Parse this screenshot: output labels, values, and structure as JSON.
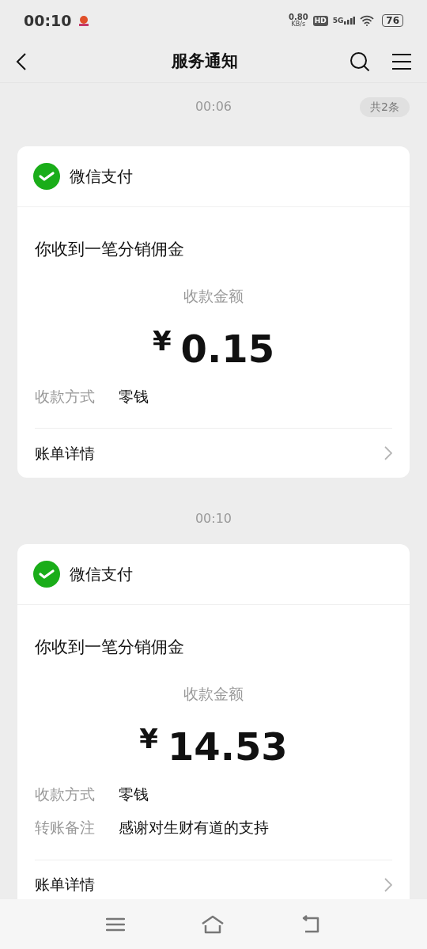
{
  "status_bar": {
    "time": "00:10",
    "speed": "0.80",
    "speed_unit": "KB/s",
    "hd": "HD",
    "network": "5G",
    "battery": "76"
  },
  "nav": {
    "title": "服务通知"
  },
  "count_badge": "共2条",
  "messages": [
    {
      "time": "00:06",
      "app": "微信支付",
      "title": "你收到一笔分销佣金",
      "amount_label": "收款金额",
      "currency": "¥",
      "amount": "0.15",
      "rows": [
        {
          "label": "收款方式",
          "value": "零钱"
        }
      ],
      "footer": "账单详情"
    },
    {
      "time": "00:10",
      "app": "微信支付",
      "title": "你收到一笔分销佣金",
      "amount_label": "收款金额",
      "currency": "¥",
      "amount": "14.53",
      "rows": [
        {
          "label": "收款方式",
          "value": "零钱"
        },
        {
          "label": "转账备注",
          "value": "感谢对生财有道的支持"
        }
      ],
      "footer": "账单详情"
    }
  ]
}
